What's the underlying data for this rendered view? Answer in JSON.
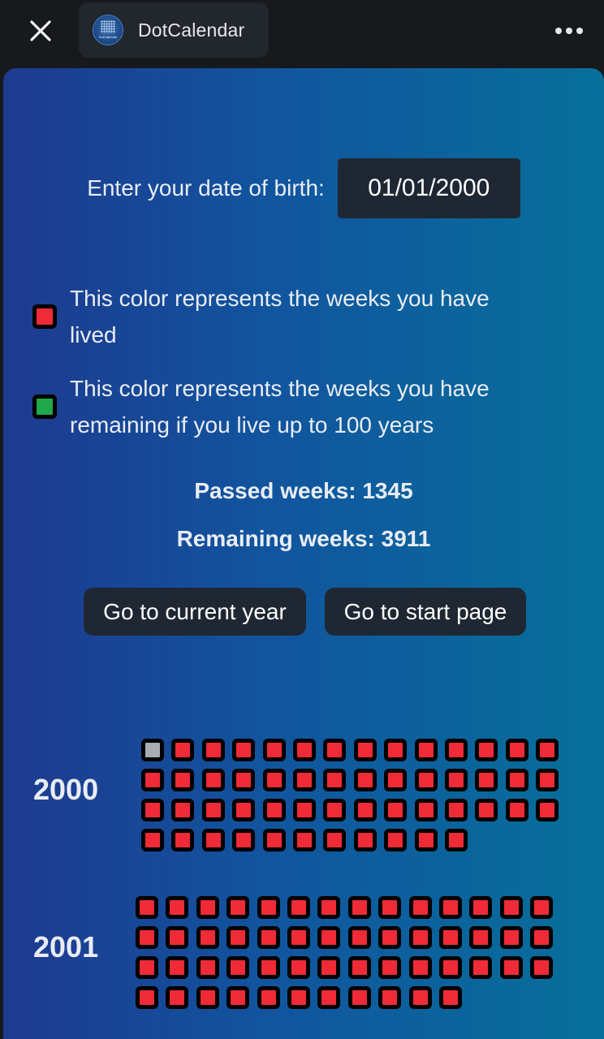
{
  "topbar": {
    "app_title": "DotCalendar",
    "logo_text": "DotCalendar",
    "close_icon": "close-icon",
    "more_icon": "more-horizontal-icon"
  },
  "form": {
    "dob_label": "Enter your date of birth:",
    "dob_value": "01/01/2000"
  },
  "legend": {
    "lived_text": "This color represents the weeks you have lived",
    "remaining_text": "This color represents the weeks you have remaining if you live up to 100 years",
    "lived_color": "#ef2b38",
    "remaining_color": "#1fa74a",
    "current_color": "#a8acb3"
  },
  "stats": {
    "passed": "Passed weeks: 1345",
    "remaining": "Remaining weeks: 3911"
  },
  "buttons": {
    "current_year": "Go to current year",
    "start_page": "Go to start page"
  },
  "years": [
    {
      "label": "2000",
      "weeks": 53,
      "current_index": 0
    },
    {
      "label": "2001",
      "weeks": 53,
      "current_index": -1
    }
  ]
}
